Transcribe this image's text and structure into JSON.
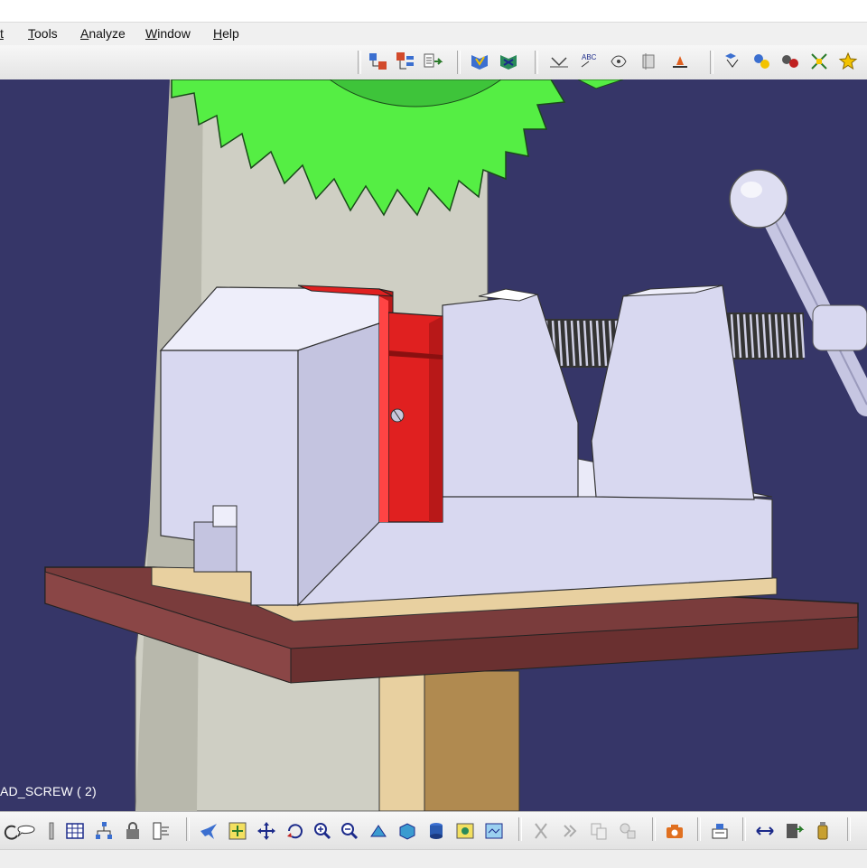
{
  "menu": {
    "items": [
      {
        "label": "t"
      },
      {
        "label": "Tools"
      },
      {
        "label": "Analyze"
      },
      {
        "label": "Window"
      },
      {
        "label": "Help"
      }
    ]
  },
  "toolbar_top": {
    "icons": [
      "product-structure-icon",
      "assembly-icon",
      "existing-component-icon",
      "fix-constraint-icon",
      "manipulate-icon",
      "snap-icon",
      "annotation-text-icon",
      "flag-note-icon",
      "section-icon",
      "measure-icon",
      "catalog-icon",
      "clash-icon",
      "distance-icon",
      "sectioning-icon",
      "scene-icon"
    ]
  },
  "viewport": {
    "background_color": "#363668",
    "status_label": "AD_SCREW ( 2)",
    "part_colors": {
      "saw_blade": "#55ee44",
      "vise_body": "#d8d8f0",
      "jaw_plates": "#e02020",
      "table_plate": "#7a3c3c",
      "base_wood": "#e8d0a0",
      "screw": "#333333"
    }
  },
  "toolbar_bottom": {
    "icons": [
      "undo-icon",
      "comment-icon",
      "bolt-icon",
      "table-icon",
      "tree-icon",
      "lock-icon",
      "spec-tree-icon",
      "fly-mode-icon",
      "fit-all-icon",
      "pan-icon",
      "rotate-icon",
      "zoom-in-icon",
      "zoom-out-icon",
      "normal-view-icon",
      "iso-view-icon",
      "shading-icon",
      "hide-show-icon",
      "swap-visible-icon",
      "cut-icon",
      "paste-icon",
      "copy-icon",
      "tools-icon",
      "camera-icon",
      "capture-icon",
      "measure-between-icon",
      "insert-icon",
      "mass-icon"
    ]
  }
}
